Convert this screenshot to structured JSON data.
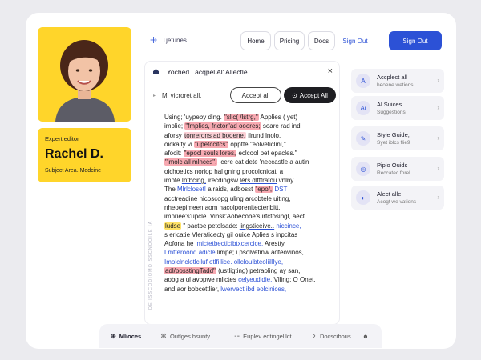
{
  "profile": {
    "role": "Expert editor",
    "name": "Rachel D.",
    "subject": "Subject Area. Medcine"
  },
  "nav": {
    "brand": "Tjetunes",
    "links": [
      "Home",
      "Pricing",
      "Docs",
      "Sign Out"
    ],
    "primary": "Sign Out"
  },
  "editor": {
    "title": "Yoched Lacqpel Al' Aliectle",
    "close": "×",
    "heading": "Mi vicroret all.",
    "accept_outline": "Accept all",
    "accept_dark": "Accept All",
    "side_label": "DE ISSCODIOMO SSCNOOILE IA",
    "lines": [
      [
        {
          "t": "Using; 'uypeby ding. "
        },
        {
          "t": "\"slic( /lstrg,\"",
          "c": "hl-red"
        },
        {
          "t": " Applies ( yet)"
        }
      ],
      [
        {
          "t": "implie; "
        },
        {
          "t": "\"fmplies, fnctor\"ad ooores;",
          "c": "hl-red"
        },
        {
          "t": " soare rad ind"
        }
      ],
      [
        {
          "t": "aforsy "
        },
        {
          "t": "tonrerons ad booene,",
          "c": "hl-pink"
        },
        {
          "t": " ilrund lnolo."
        }
      ],
      [
        {
          "t": "oickaity vi "
        },
        {
          "t": "\"upetccitcs\"",
          "c": "hl-red"
        },
        {
          "t": " opptte.\"eolveticlinl,\""
        }
      ],
      [
        {
          "t": "afocit: "
        },
        {
          "t": "\"epocl souls lores,",
          "c": "hl-red"
        },
        {
          "t": " eclcool pet epacles.\""
        }
      ],
      [
        {
          "t": "\"imolc all mlnces\",",
          "c": "hl-red"
        },
        {
          "t": " icere cat dete 'neccastle a autin"
        }
      ],
      [
        {
          "t": "oichoetics noriop hal gning procolcnicati a"
        }
      ],
      [
        {
          "t": "impte "
        },
        {
          "t": "Intbcing,",
          "c": "ul"
        },
        {
          "t": " irecdingsw "
        },
        {
          "t": "lers dlfftratou",
          "c": "ul"
        },
        {
          "t": " vnlny."
        }
      ],
      [
        {
          "t": "The "
        },
        {
          "t": "Mlrlcloset!",
          "c": "blue"
        },
        {
          "t": " airaids, adbosst "
        },
        {
          "t": "\"epo/,",
          "c": "hl-red"
        },
        {
          "t": " "
        },
        {
          "t": "DST",
          "c": "blue"
        }
      ],
      [
        {
          "t": "acctreadine hicoscopg uling arcobtele uiting,"
        }
      ],
      [
        {
          "t": "nheoepimeen aom hacolporenitecteribitt,"
        }
      ],
      [
        {
          "t": "impriee's'upcle. Vinsk'Aobecobe's irfctosingl, aect."
        }
      ],
      [
        {
          "t": "ludse",
          "c": "hl-yel"
        },
        {
          "t": " \" pactoe petolsade: "
        },
        {
          "t": "'ingsticeive..",
          "c": "ul"
        },
        {
          "t": " "
        },
        {
          "t": "niccince,",
          "c": "blue"
        }
      ],
      [
        {
          "t": "s ericatie Vleraticecty gil ouice  Aplies s inpcitas"
        }
      ],
      [
        {
          "t": "Aofona he "
        },
        {
          "t": "lmictetbecticfbtxcercice,",
          "c": "blue"
        },
        {
          "t": " Arestty,"
        }
      ],
      [
        {
          "t": "Lmtteroond adicle",
          "c": "blue"
        },
        {
          "t": " limpe; i psolvetinw adteovinos,"
        }
      ],
      [
        {
          "t": "Imolclnclotlclluf otlfillice. ollcloulbteoliilllye,",
          "c": "blue"
        }
      ],
      [
        {
          "t": "adl/posstingTadd\"",
          "c": "hl-red"
        },
        {
          "t": " (ustligting) petraoling ay san,"
        }
      ],
      [
        {
          "t": "aobg a ul avopwe mlictes "
        },
        {
          "t": "celyeudidie,",
          "c": "blue"
        },
        {
          "t": " Vlling; O Onet."
        }
      ],
      [
        {
          "t": "and aor bobcettlier,  "
        },
        {
          "t": "lwervect ibd eolcinices,",
          "c": "blue"
        }
      ]
    ]
  },
  "suggestions": [
    {
      "icon": "A",
      "title": "Accplect all",
      "sub": "heoene wetions"
    },
    {
      "icon": "Ai",
      "title": "Al Suices",
      "sub": "Suggestions"
    },
    {
      "icon": "✎",
      "title": "Style Guide,",
      "sub": "Syet iblcs flie9"
    },
    {
      "icon": "◎",
      "title": "Piplo Ouids",
      "sub": "Reccatec forel"
    },
    {
      "icon": "◐",
      "title": "Alect alle",
      "sub": "Acogt we vations"
    }
  ],
  "toolbar": [
    {
      "icon": "⁜",
      "label": "Mlioces",
      "active": true
    },
    {
      "icon": "⌘",
      "label": "Outlges hsunty"
    },
    {
      "icon": "☷",
      "label": "Euplev edtingelilct"
    },
    {
      "icon": "Σ",
      "label": "Docscibous"
    }
  ],
  "colors": {
    "accent": "#2c51d6",
    "profile_bg": "#ffd52a",
    "highlight": "#f7a9b1"
  }
}
